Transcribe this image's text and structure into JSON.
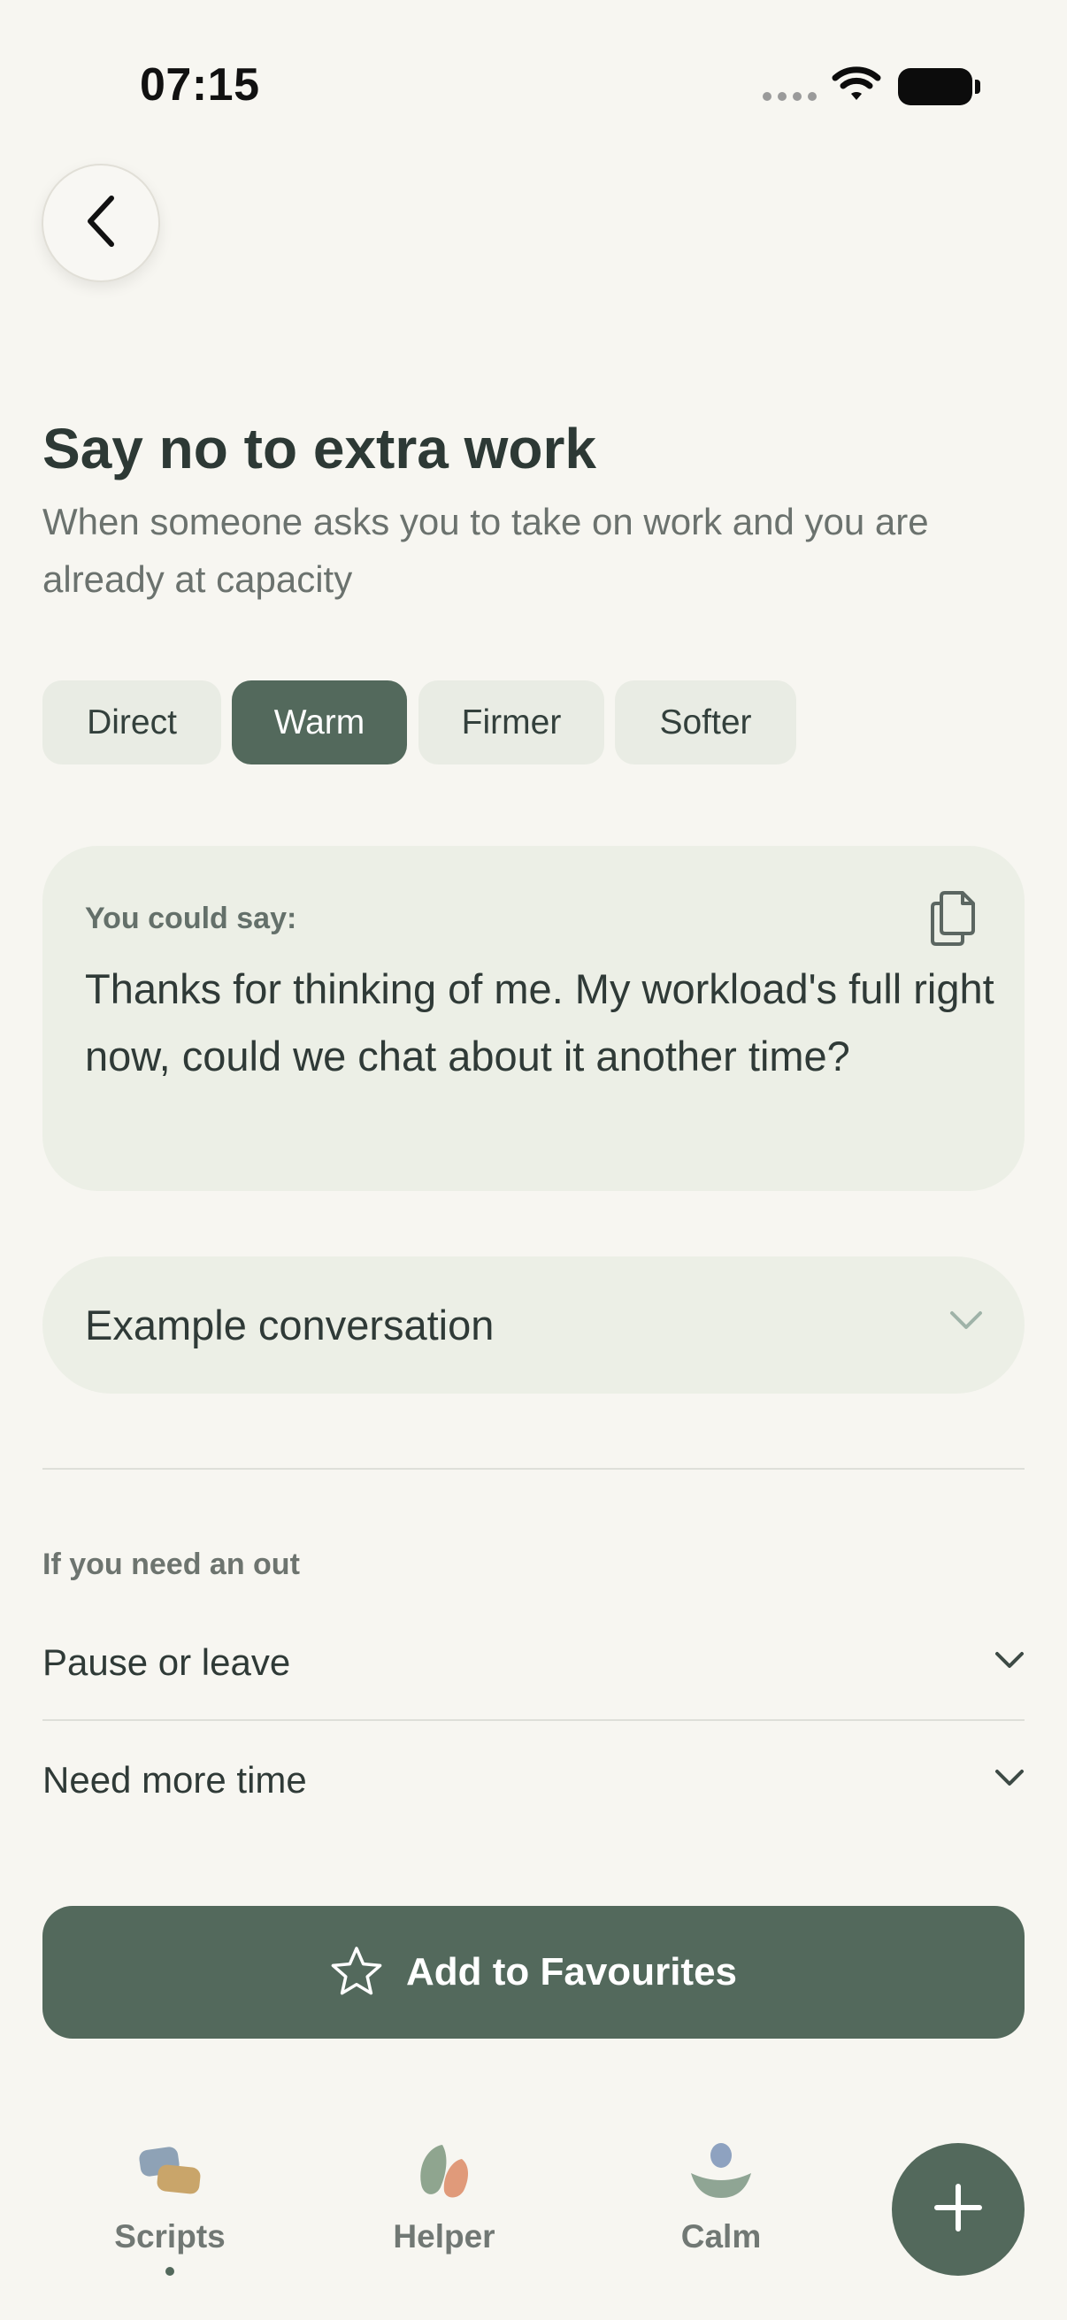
{
  "status_bar": {
    "time": "07:15"
  },
  "page": {
    "title": "Say no to extra work",
    "subtitle": "When someone asks you to take on work and you are already at capacity"
  },
  "tones": [
    {
      "label": "Direct",
      "selected": false
    },
    {
      "label": "Warm",
      "selected": true
    },
    {
      "label": "Firmer",
      "selected": false
    },
    {
      "label": "Softer",
      "selected": false
    }
  ],
  "script_card": {
    "label": "You could say:",
    "text": "Thanks for thinking of me. My workload's full right now, could we chat about it another time?"
  },
  "example": {
    "label": "Example conversation"
  },
  "outs": {
    "label": "If you need an out",
    "items": [
      {
        "label": "Pause or leave"
      },
      {
        "label": "Need more time"
      }
    ]
  },
  "favourite_button": {
    "label": "Add to Favourites"
  },
  "nav": {
    "items": [
      {
        "label": "Scripts",
        "active": true
      },
      {
        "label": "Helper",
        "active": false
      },
      {
        "label": "Calm",
        "active": false
      }
    ]
  },
  "colors": {
    "background": "#f7f6f1",
    "accent": "#53695c",
    "card": "#ecefe6",
    "pill": "#e9ece4"
  },
  "icons": [
    "back-chevron-icon",
    "copy-icon",
    "chevron-down-icon",
    "star-icon",
    "plus-icon",
    "wifi-icon",
    "battery-icon"
  ]
}
